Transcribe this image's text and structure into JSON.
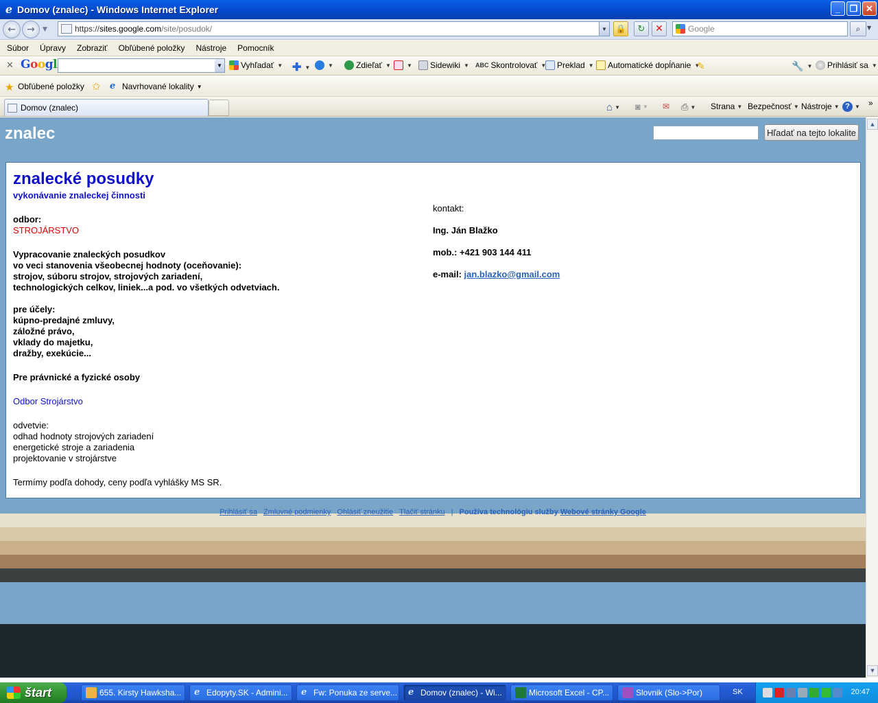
{
  "window": {
    "title": "Domov (znalec) - Windows Internet Explorer",
    "buttons": {
      "minimize": "_",
      "maximize": "❐",
      "close": "✕"
    }
  },
  "address": {
    "url_prefix": "https://",
    "url_domain": "sites.google.com",
    "url_path": "/site/posudok/",
    "search_placeholder": "Google"
  },
  "menu": [
    "Súbor",
    "Úpravy",
    "Zobraziť",
    "Obľúbené položky",
    "Nástroje",
    "Pomocník"
  ],
  "google_toolbar": {
    "logo": "Google",
    "items": {
      "search": "Vyhľadať",
      "share": "Zdieľať",
      "sidewiki": "Sidewiki",
      "spellcheck": "Skontrolovať",
      "translate": "Preklad",
      "autofill": "Automatické dopĺňanie",
      "signin": "Prihlásiť sa"
    }
  },
  "favorites_bar": {
    "favorites": "Obľúbené položky",
    "suggested": "Navrhované lokality"
  },
  "tab": {
    "title": "Domov (znalec)"
  },
  "command_bar": {
    "page": "Strana",
    "safety": "Bezpečnosť",
    "tools": "Nástroje"
  },
  "site": {
    "title": "znalec",
    "search_button": "Hľadať na tejto lokalite",
    "heading": "znalecké posudky",
    "subtitle": "vykonávanie znaleckej činnosti",
    "odbor_label": "odbor:",
    "odbor_value": "STROJÁRSTVO",
    "desc": [
      "Vypracovanie znaleckých posudkov",
      "vo veci stanovenia všeobecnej hodnoty (oceňovanie):",
      "strojov, súboru strojov, strojových zariadení,",
      "technologických celkov, liniek...a pod. vo všetkých odvetviach."
    ],
    "purposes": [
      "pre účely:",
      "kúpno-predajné zmluvy,",
      "záložné právo,",
      "vklady do majetku,",
      "dražby, exekúcie..."
    ],
    "clients": "Pre právnické a fyzické osoby",
    "odbor_link": "Odbor Strojárstvo",
    "branches": [
      "odvetvie:",
      "odhad hodnoty strojových zariadení",
      "energetické stroje a zariadenia",
      "projektovanie v strojárstve"
    ],
    "terms": "Termímy podľa dohody, ceny podľa vyhlášky MS SR.",
    "contact_label": "kontakt:",
    "contact_name": "Ing. Ján Blažko",
    "contact_mobile": "mob.: +421 903 144 411",
    "contact_email_label": "e-mail: ",
    "contact_email": "jan.blazko@gmail.com",
    "footer": {
      "signin": "Prihlásiť sa",
      "terms": "Zmluvné podmienky",
      "report": "Ohlásiť zneužitie",
      "print": "Tlačiť stránku",
      "sep": "|",
      "powered": "Používa technológiu služby ",
      "powered_link": "Webové stránky Google"
    }
  },
  "taskbar": {
    "start": "štart",
    "items": [
      "655. Kirsty Hawksha...",
      "Edopyty.SK - Admini...",
      "Fw: Ponuka ze serve...",
      "Domov (znalec) - Wi...",
      "Microsoft Excel - CP...",
      "Slovnik (Slo->Por)"
    ],
    "lang": "SK",
    "clock": "20:47"
  }
}
